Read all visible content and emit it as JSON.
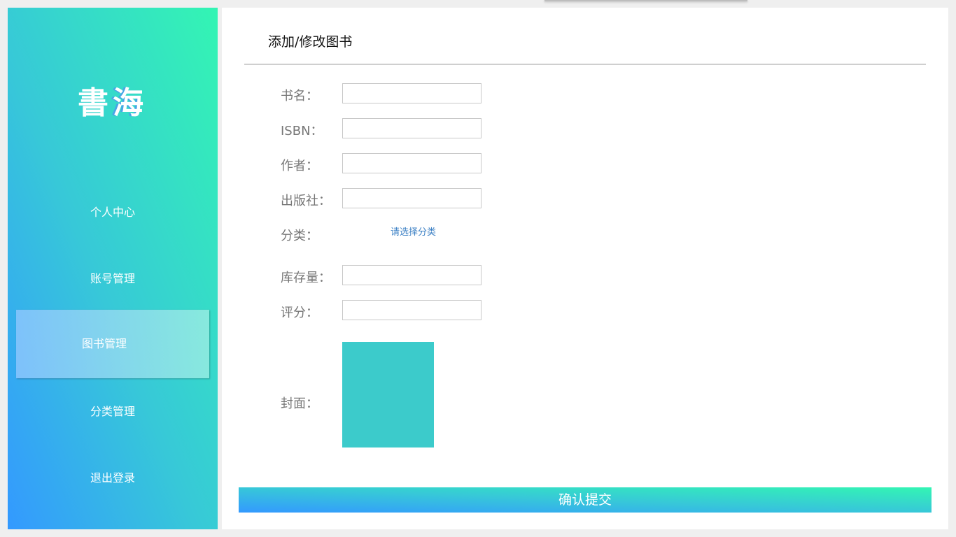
{
  "sidebar": {
    "logo_char_1": "書",
    "logo_char_2": "海",
    "items": [
      {
        "label": "个人中心"
      },
      {
        "label": "账号管理"
      },
      {
        "label": "图书管理"
      },
      {
        "label": "分类管理"
      },
      {
        "label": "退出登录"
      }
    ],
    "active_index": 2
  },
  "main": {
    "title": "添加/修改图书",
    "fields": {
      "name": {
        "label": "书名：",
        "value": ""
      },
      "isbn": {
        "label": "ISBN：",
        "value": ""
      },
      "author": {
        "label": "作者：",
        "value": ""
      },
      "publisher": {
        "label": "出版社：",
        "value": ""
      },
      "category": {
        "label": "分类：",
        "select_text": "请选择分类"
      },
      "stock": {
        "label": "库存量：",
        "value": ""
      },
      "rating": {
        "label": "评分：",
        "value": ""
      },
      "cover": {
        "label": "封面："
      }
    },
    "submit_label": "确认提交"
  },
  "colors": {
    "gradient_start": "#3399ff",
    "gradient_mid": "#37c8d8",
    "gradient_end": "#33f5b3",
    "cover_placeholder": "#3ccbcb",
    "link": "#3a7fc4"
  }
}
